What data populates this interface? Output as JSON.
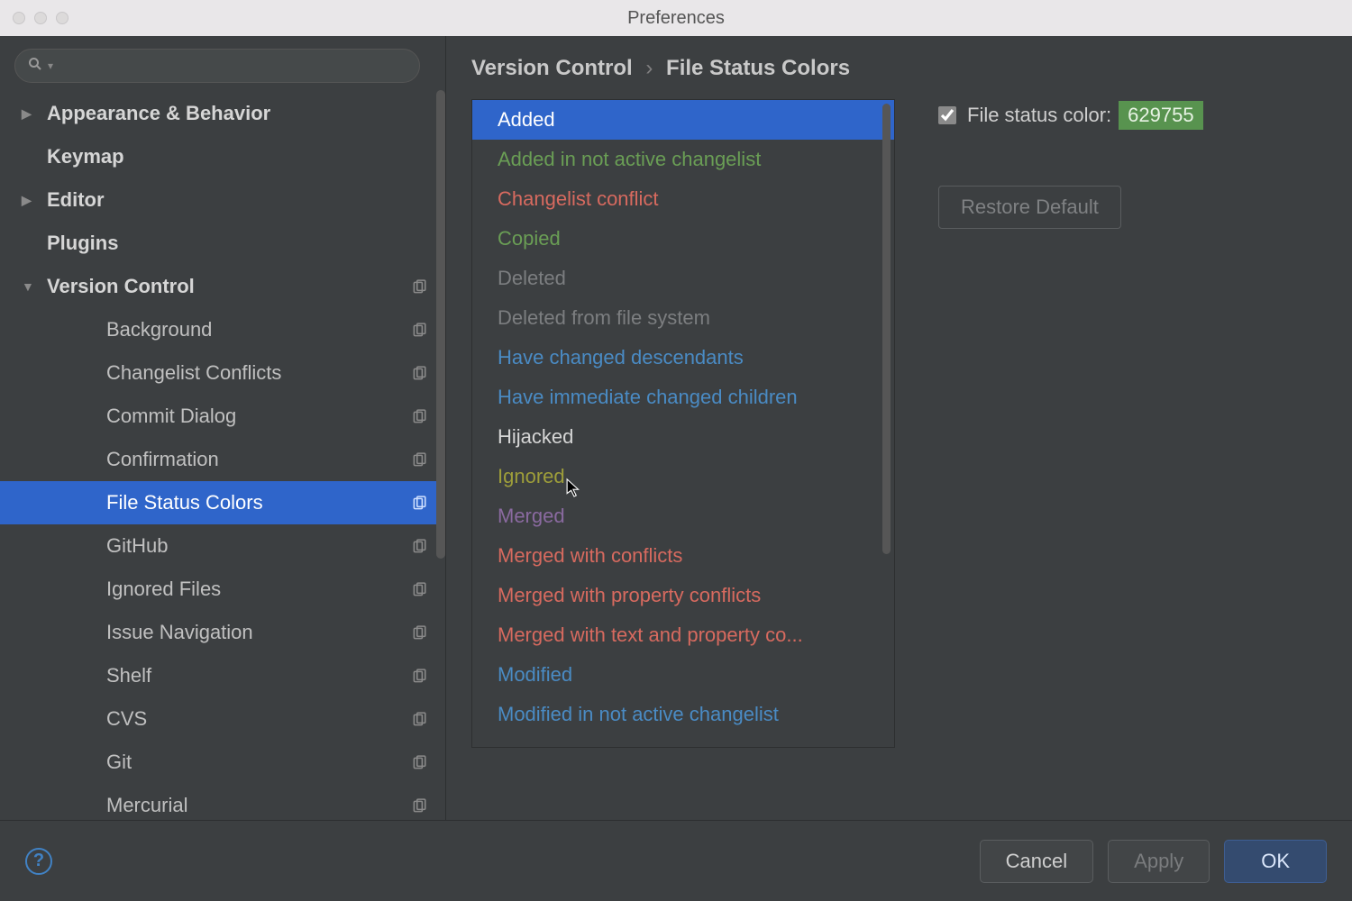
{
  "window": {
    "title": "Preferences"
  },
  "search": {
    "placeholder": ""
  },
  "breadcrumb": {
    "parent": "Version Control",
    "sep": "›",
    "page": "File Status Colors"
  },
  "sidebar": {
    "items": [
      {
        "label": "Appearance & Behavior",
        "bold": true,
        "disc": "right",
        "indent": 0,
        "copy": false
      },
      {
        "label": "Keymap",
        "bold": true,
        "disc": "none",
        "indent": 0,
        "copy": false
      },
      {
        "label": "Editor",
        "bold": true,
        "disc": "right",
        "indent": 0,
        "copy": false
      },
      {
        "label": "Plugins",
        "bold": true,
        "disc": "none",
        "indent": 0,
        "copy": false
      },
      {
        "label": "Version Control",
        "bold": true,
        "disc": "down",
        "indent": 0,
        "copy": true
      },
      {
        "label": "Background",
        "bold": false,
        "disc": "none",
        "indent": 2,
        "copy": true
      },
      {
        "label": "Changelist Conflicts",
        "bold": false,
        "disc": "none",
        "indent": 2,
        "copy": true
      },
      {
        "label": "Commit Dialog",
        "bold": false,
        "disc": "none",
        "indent": 2,
        "copy": true
      },
      {
        "label": "Confirmation",
        "bold": false,
        "disc": "none",
        "indent": 2,
        "copy": true
      },
      {
        "label": "File Status Colors",
        "bold": false,
        "disc": "none",
        "indent": 2,
        "copy": true,
        "selected": true
      },
      {
        "label": "GitHub",
        "bold": false,
        "disc": "none",
        "indent": 2,
        "copy": true
      },
      {
        "label": "Ignored Files",
        "bold": false,
        "disc": "none",
        "indent": 2,
        "copy": true
      },
      {
        "label": "Issue Navigation",
        "bold": false,
        "disc": "none",
        "indent": 2,
        "copy": true
      },
      {
        "label": "Shelf",
        "bold": false,
        "disc": "none",
        "indent": 2,
        "copy": true
      },
      {
        "label": "CVS",
        "bold": false,
        "disc": "none",
        "indent": 2,
        "copy": true
      },
      {
        "label": "Git",
        "bold": false,
        "disc": "none",
        "indent": 2,
        "copy": true
      },
      {
        "label": "Mercurial",
        "bold": false,
        "disc": "none",
        "indent": 2,
        "copy": true
      }
    ]
  },
  "statuses": [
    {
      "label": "Added",
      "color": "#ffffff",
      "selected": true
    },
    {
      "label": "Added in not active changelist",
      "color": "#6a9e55"
    },
    {
      "label": "Changelist conflict",
      "color": "#d76a5f"
    },
    {
      "label": "Copied",
      "color": "#6a9e55"
    },
    {
      "label": "Deleted",
      "color": "#7c7e80"
    },
    {
      "label": "Deleted from file system",
      "color": "#7c7e80"
    },
    {
      "label": "Have changed descendants",
      "color": "#4a8bc4"
    },
    {
      "label": "Have immediate changed children",
      "color": "#4a8bc4"
    },
    {
      "label": "Hijacked",
      "color": "#d6d6d6"
    },
    {
      "label": "Ignored",
      "color": "#9e9e3a"
    },
    {
      "label": "Merged",
      "color": "#8a6aa0"
    },
    {
      "label": "Merged with conflicts",
      "color": "#d76a5f"
    },
    {
      "label": "Merged with property conflicts",
      "color": "#d76a5f"
    },
    {
      "label": "Merged with text and property co...",
      "color": "#d76a5f"
    },
    {
      "label": "Modified",
      "color": "#4a8bc4"
    },
    {
      "label": "Modified in not active changelist",
      "color": "#4a8bc4"
    }
  ],
  "right": {
    "checkbox_label": "File status color:",
    "checked": true,
    "color_hex": "629755",
    "restore_label": "Restore Default"
  },
  "footer": {
    "cancel": "Cancel",
    "apply": "Apply",
    "ok": "OK"
  }
}
